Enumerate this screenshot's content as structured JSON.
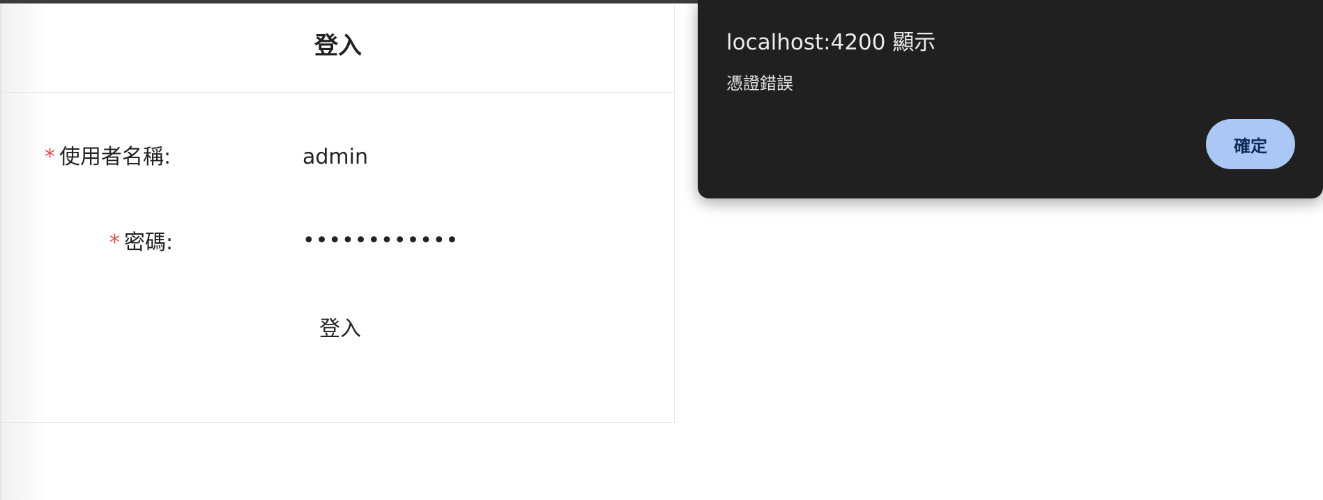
{
  "login_form": {
    "title": "登入",
    "username": {
      "required_mark": "*",
      "label": "使用者名稱:",
      "value": "admin"
    },
    "password": {
      "required_mark": "*",
      "label": "密碼:",
      "masked_value": "••••••••••••"
    },
    "submit_label": "登入"
  },
  "alert_dialog": {
    "title": "localhost:4200 顯示",
    "message": "憑證錯誤",
    "confirm_label": "確定"
  },
  "colors": {
    "required_mark": "#e5484d",
    "dialog_background": "#202020",
    "confirm_button": "#aac7f5",
    "confirm_text": "#0f2a55"
  }
}
